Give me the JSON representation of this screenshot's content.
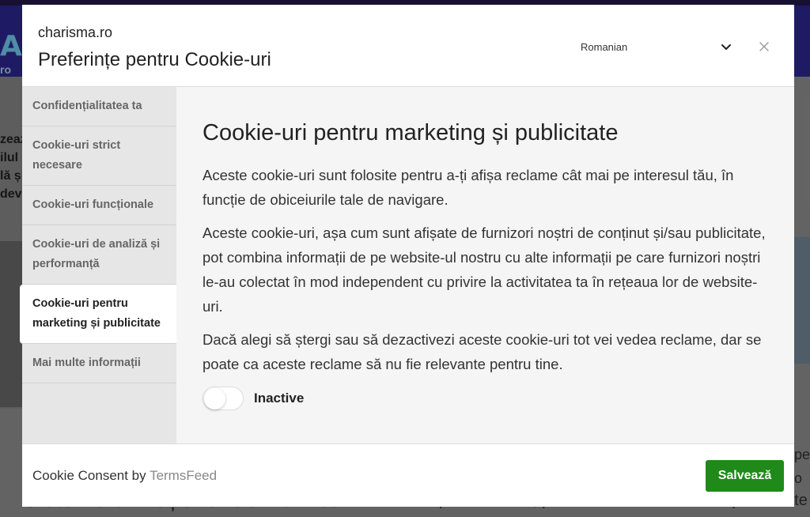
{
  "background": {
    "logo_fragment": "A",
    "header_fragment": "ro",
    "left_text": [
      "zeaz",
      "ilul",
      "lă și",
      "devi"
    ],
    "bottom_left_text": "Sistemului Național de Verificări",
    "bottom_right_text": "personalizate, pentru a analiza traficul de pe website",
    "right_side_text": [
      "pe",
      "o"
    ]
  },
  "modal": {
    "site_name": "charisma.ro",
    "title": "Preferințe pentru Cookie-uri",
    "language": {
      "selected": "Romanian"
    },
    "sidebar": {
      "items": [
        {
          "label": "Confidențialitatea ta",
          "active": false
        },
        {
          "label": "Cookie-uri strict necesare",
          "active": false
        },
        {
          "label": "Cookie-uri funcționale",
          "active": false
        },
        {
          "label": "Cookie-uri de analiză și performanță",
          "active": false
        },
        {
          "label": "Cookie-uri pentru marketing și publicitate",
          "active": true
        },
        {
          "label": "Mai multe informații",
          "active": false
        }
      ]
    },
    "content": {
      "heading": "Cookie-uri pentru marketing și publicitate",
      "paragraphs": [
        "Aceste cookie-uri sunt folosite pentru a-ți afișa reclame cât mai pe interesul tău, în funcție de obiceiurile tale de navigare.",
        "Aceste cookie-uri, așa cum sunt afișate de furnizori noștri de conținut și/sau publicitate, pot combina informații de pe website-ul nostru cu alte informații pe care furnizori noștri le-au colectat în mod independent cu privire la activitatea ta în rețeaua lor de website-uri.",
        "Dacă alegi să ștergi sau să dezactivezi aceste cookie-uri tot vei vedea reclame, dar se poate ca aceste reclame să nu fie relevante pentru tine."
      ],
      "toggle_label": "Inactive",
      "toggle_on": false
    },
    "footer": {
      "prefix": "Cookie Consent by ",
      "brand": "TermsFeed",
      "save_label": "Salvează"
    }
  },
  "colors": {
    "save_button": "#1f8a19",
    "header_bg": "#2f2a9a",
    "sidebar_bg": "#e6e6e6",
    "content_bg": "#f5f5f5"
  }
}
